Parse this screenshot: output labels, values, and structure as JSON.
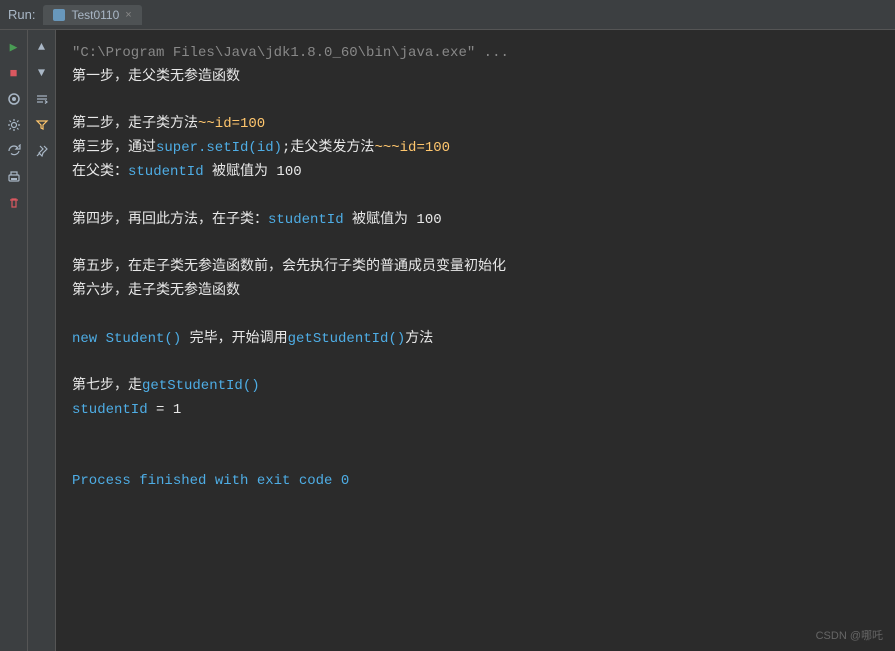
{
  "topbar": {
    "run_label": "Run:",
    "tab_name": "Test0110",
    "tab_close": "×"
  },
  "toolbar_left": {
    "buttons": [
      {
        "name": "play",
        "icon": "▶",
        "class": "green"
      },
      {
        "name": "stop",
        "icon": "■",
        "class": "red"
      },
      {
        "name": "snapshot",
        "icon": "📷",
        "class": ""
      },
      {
        "name": "settings",
        "icon": "⚙",
        "class": ""
      },
      {
        "name": "rerun",
        "icon": "↩",
        "class": ""
      },
      {
        "name": "print",
        "icon": "🖨",
        "class": ""
      },
      {
        "name": "delete",
        "icon": "🗑",
        "class": "red"
      }
    ]
  },
  "side_toolbar": {
    "buttons": [
      {
        "name": "up",
        "icon": "↑"
      },
      {
        "name": "down",
        "icon": "↓"
      },
      {
        "name": "wrap",
        "icon": "≡"
      },
      {
        "name": "filter",
        "icon": "⇅"
      },
      {
        "name": "pin",
        "icon": "📌"
      }
    ]
  },
  "output": {
    "lines": [
      {
        "text": "\"C:\\Program Files\\Java\\jdk1.8.0_60\\bin\\java.exe\" ...",
        "color": "gray"
      },
      {
        "text": "第一步，走父类无参造函数",
        "color": "white"
      },
      {
        "text": "",
        "color": "empty"
      },
      {
        "text": "第二步，走子类方法~~id=100",
        "color": "orange"
      },
      {
        "text": "第三步，通过super.setId(id);走父类发方法~~~id=100",
        "color": "white"
      },
      {
        "text": "在父类：studentId 被赋值为 100",
        "color": "white"
      },
      {
        "text": "",
        "color": "empty"
      },
      {
        "text": "第四步，再回此方法，在子类：studentId 被赋值为 100",
        "color": "white"
      },
      {
        "text": "",
        "color": "empty"
      },
      {
        "text": "第五步，在走子类无参造函数前，会先执行子类的普通成员变量初始化",
        "color": "white"
      },
      {
        "text": "第六步，走子类无参造函数",
        "color": "white"
      },
      {
        "text": "",
        "color": "empty"
      },
      {
        "text": "new Student() 完毕，开始调用getStudentId()方法",
        "color": "white"
      },
      {
        "text": "",
        "color": "empty"
      },
      {
        "text": "第七步，走getStudentId()",
        "color": "white"
      },
      {
        "text": "studentId = 1",
        "color": "white"
      },
      {
        "text": "",
        "color": "empty"
      },
      {
        "text": "",
        "color": "empty"
      },
      {
        "text": "Process finished with exit code 0",
        "color": "process"
      }
    ]
  },
  "watermark": "CSDN @哪吒"
}
